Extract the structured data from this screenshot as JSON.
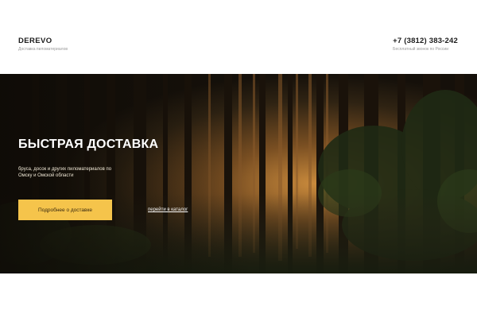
{
  "header": {
    "logo": "DEREVO",
    "tagline": "Доставка пиломатериалов",
    "phone": "+7 (3812) 383-242",
    "phone_note": "Бесплатный звонок по России"
  },
  "hero": {
    "title": "БЫСТРАЯ ДОСТАВКА",
    "description": "бруса, досок и других пиломатериалов по Омску и Омской области",
    "cta_label": "Подробнее о доставке",
    "catalog_link": "перейти в каталог",
    "background_image": "forest-icon"
  },
  "colors": {
    "accent": "#f5c44b",
    "hero_dark": "#1f160b",
    "text_dark": "#1c1c1c"
  }
}
